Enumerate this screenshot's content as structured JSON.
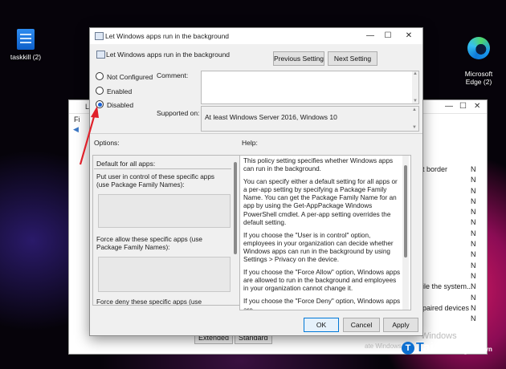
{
  "desktop": {
    "icons": [
      {
        "label": "taskkill (2)",
        "icon": "batch-file-icon"
      },
      {
        "label": "Microsoft\nEdge (2)",
        "icon": "edge-icon"
      }
    ]
  },
  "background_window": {
    "title": "Lo",
    "menu_text": "Fi",
    "partial_rows": [
      {
        "name": "t border",
        "state": "N"
      },
      {
        "name": "",
        "state": "N"
      },
      {
        "name": "",
        "state": "N"
      },
      {
        "name": "",
        "state": "N"
      },
      {
        "name": "",
        "state": "N"
      },
      {
        "name": "",
        "state": "N"
      },
      {
        "name": "",
        "state": "N"
      },
      {
        "name": "",
        "state": "N"
      },
      {
        "name": "",
        "state": "N"
      },
      {
        "name": "",
        "state": "N"
      },
      {
        "name": "",
        "state": "N"
      },
      {
        "name": "ile the system...",
        "state": "N"
      },
      {
        "name": "",
        "state": "N"
      },
      {
        "name": "paired devices",
        "state": "N"
      },
      {
        "name": "",
        "state": "N"
      }
    ],
    "tabs": [
      "Extended",
      "Standard"
    ],
    "activate_text": "Windows",
    "activate_sub": "ate Windows."
  },
  "dialog": {
    "title": "Let Windows apps run in the background",
    "header": "Let Windows apps run in the background",
    "prev_button": "Previous Setting",
    "next_button": "Next Setting",
    "radios": [
      {
        "label": "Not Configured",
        "selected": false
      },
      {
        "label": "Enabled",
        "selected": false
      },
      {
        "label": "Disabled",
        "selected": true
      }
    ],
    "comment_label": "Comment:",
    "supported_label": "Supported on:",
    "supported_value": "At least Windows Server 2016, Windows 10",
    "options_label": "Options:",
    "help_label": "Help:",
    "options": {
      "dropdown": "Default for all apps:",
      "user_control_text": "Put user in control of these specific apps (use Package Family Names):",
      "force_allow_text": "Force allow these specific apps (use Package Family Names):",
      "force_deny_text": "Force deny these specific apps (use Package"
    },
    "help_paragraphs": [
      "This policy setting specifies whether Windows apps can run in the background.",
      "You can specify either a default setting for all apps or a per-app setting by specifying a Package Family Name. You can get the Package Family Name for an app by using the Get-AppPackage Windows PowerShell cmdlet. A per-app setting overrides the default setting.",
      "If you choose the \"User is in control\" option, employees in your organization can decide whether Windows apps can run in the background by using Settings > Privacy on the device.",
      "If you choose the \"Force Allow\" option, Windows apps are allowed to run in the background and employees in your organization cannot change it.",
      "If you choose the \"Force Deny\" option, Windows apps are"
    ],
    "ok_button": "OK",
    "cancel_button": "Cancel",
    "apply_button": "Apply"
  },
  "watermark": {
    "logo_letter": "T",
    "brand_first": "T",
    "brand_rest": "aimienphi",
    "brand_suffix": ".vn"
  },
  "colors": {
    "arrow": "#e0202a",
    "selected_radio": "#1a61d6",
    "primary_border": "#0078d7"
  }
}
